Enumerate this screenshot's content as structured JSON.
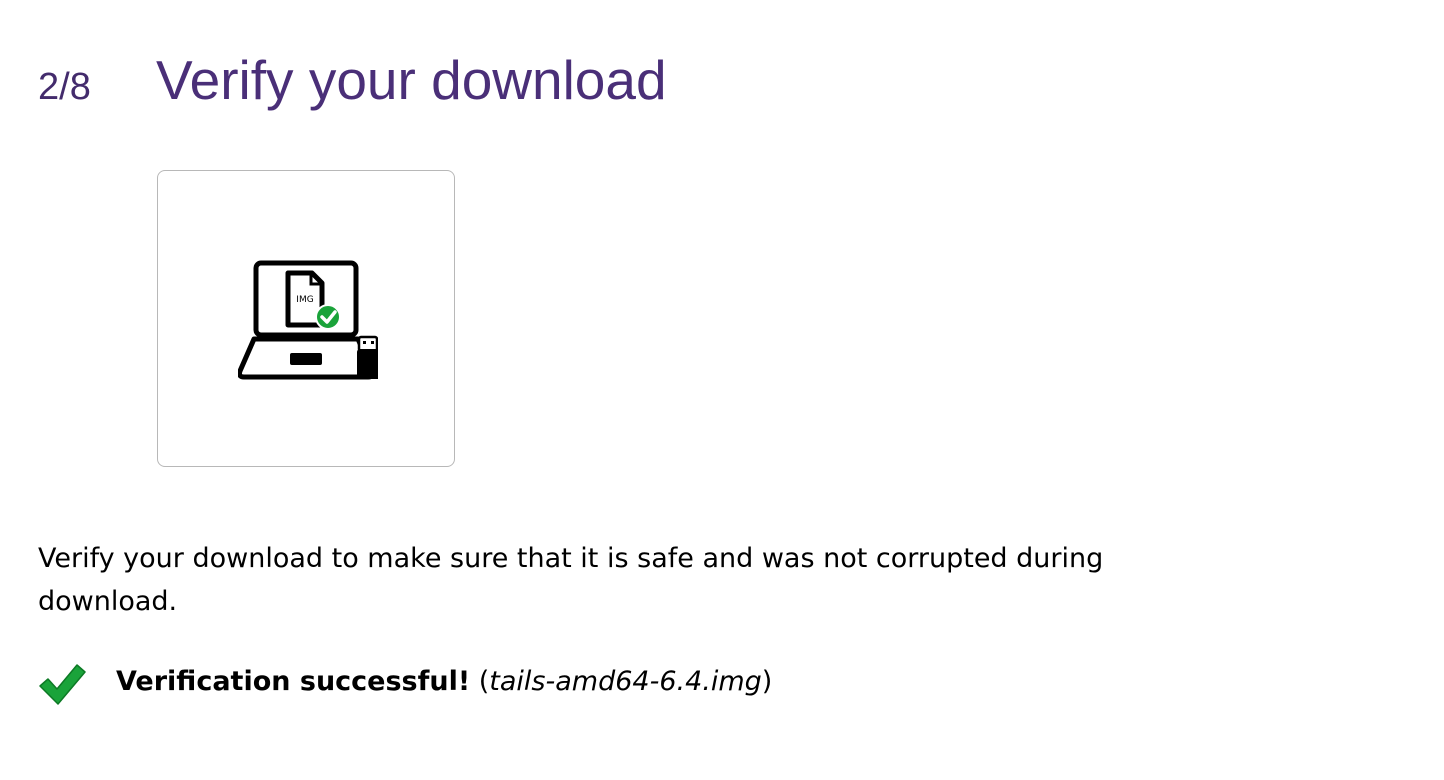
{
  "step": {
    "counter": "2/8",
    "title": "Verify your download"
  },
  "illustration": {
    "file_label": "IMG",
    "icons": [
      "laptop-icon",
      "image-file-icon",
      "checkmark-badge-icon",
      "usb-stick-icon"
    ]
  },
  "description": "Verify your download to make sure that it is safe and was not corrupted during download.",
  "verification": {
    "status_label": "Verification successful!",
    "paren_open": " (",
    "filename": "tails-amd64-6.4.img",
    "paren_close": ")",
    "icon": "green-checkmark-icon"
  },
  "colors": {
    "title": "#4a2f78",
    "success": "#1aa33a",
    "border": "#b8b8b8"
  }
}
